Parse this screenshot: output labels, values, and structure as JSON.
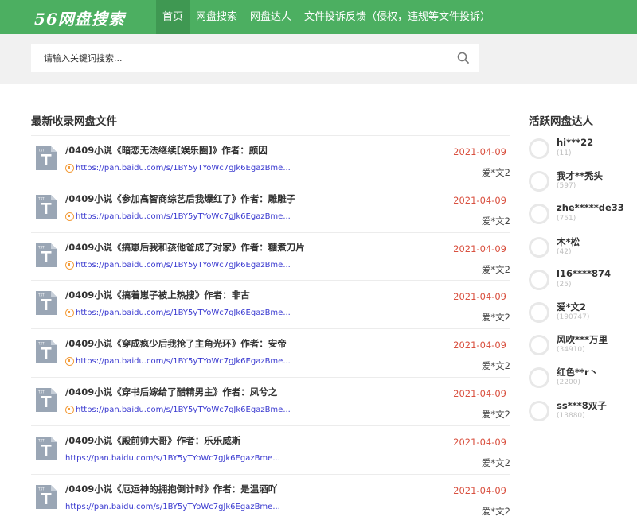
{
  "header": {
    "logo": "56网盘搜索",
    "nav": [
      "首页",
      "网盘搜索",
      "网盘达人",
      "文件投诉反馈（侵权，违规等文件投诉）"
    ]
  },
  "search": {
    "placeholder": "请输入关键词搜索..."
  },
  "main": {
    "title": "最新收录网盘文件",
    "items": [
      {
        "title": "/0409小说《暗恋无法继续[娱乐圈]》作者：颇因",
        "link": "https://pan.baidu.com/s/1BY5yTYoWc7gJk6EgazBme...",
        "date": "2021-04-09",
        "user": "爱*文2",
        "has_source_icon": true
      },
      {
        "title": "/0409小说《参加高智商综艺后我爆红了》作者：雕雕子",
        "link": "https://pan.baidu.com/s/1BY5yTYoWc7gJk6EgazBme...",
        "date": "2021-04-09",
        "user": "爱*文2",
        "has_source_icon": true
      },
      {
        "title": "/0409小说《搞崽后我和孩他爸成了对家》作者：糖煮刀片",
        "link": "https://pan.baidu.com/s/1BY5yTYoWc7gJk6EgazBme...",
        "date": "2021-04-09",
        "user": "爱*文2",
        "has_source_icon": true
      },
      {
        "title": "/0409小说《搞着崽子被上热搜》作者：非古",
        "link": "https://pan.baidu.com/s/1BY5yTYoWc7gJk6EgazBme...",
        "date": "2021-04-09",
        "user": "爱*文2",
        "has_source_icon": true
      },
      {
        "title": "/0409小说《穿成疯少后我抢了主角光环》作者：安帝",
        "link": "https://pan.baidu.com/s/1BY5yTYoWc7gJk6EgazBme...",
        "date": "2021-04-09",
        "user": "爱*文2",
        "has_source_icon": true
      },
      {
        "title": "/0409小说《穿书后嫁给了醋精男主》作者：凤兮之",
        "link": "https://pan.baidu.com/s/1BY5yTYoWc7gJk6EgazBme...",
        "date": "2021-04-09",
        "user": "爱*文2",
        "has_source_icon": true
      },
      {
        "title": "/0409小说《殿前帅大哥》作者：乐乐威斯",
        "link": "https://pan.baidu.com/s/1BY5yTYoWc7gJk6EgazBme...",
        "date": "2021-04-09",
        "user": "爱*文2",
        "has_source_icon": false
      },
      {
        "title": "/0409小说《厄运神的拥抱倒计时》作者：是温酒吖",
        "link": "https://pan.baidu.com/s/1BY5yTYoWc7gJk6EgazBme...",
        "date": "2021-04-09",
        "user": "爱*文2",
        "has_source_icon": false
      }
    ]
  },
  "sidebar": {
    "title": "活跃网盘达人",
    "users": [
      {
        "name": "hi***22",
        "count": "(11)"
      },
      {
        "name": "我才**秃头",
        "count": "(597)"
      },
      {
        "name": "zhe*****de33",
        "count": "(751)"
      },
      {
        "name": "木*松",
        "count": "(42)"
      },
      {
        "name": "l16****874",
        "count": "(25)"
      },
      {
        "name": "爱*文2",
        "count": "(190747)"
      },
      {
        "name": "风吹***万里",
        "count": "(34910)"
      },
      {
        "name": "红色**r丶",
        "count": "(2200)"
      },
      {
        "name": "ss***8双子",
        "count": "(13880)"
      }
    ]
  },
  "colors": {
    "header": "#4caf61",
    "nav_active": "#3f9852",
    "date": "#d9503f",
    "link": "#3a3ad0"
  },
  "icons": {
    "file": "txt-file-icon",
    "search": "search-icon",
    "source": "clock-icon"
  }
}
